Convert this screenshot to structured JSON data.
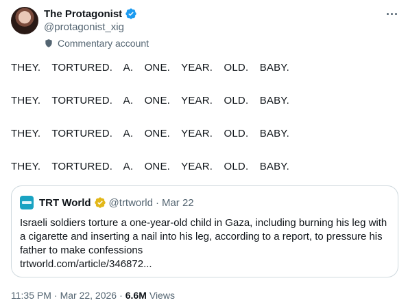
{
  "author": {
    "display_name": "The Protagonist",
    "handle": "@protagonist_xig",
    "label": "Commentary account"
  },
  "post": {
    "lines": [
      "THEY. TORTURED. A. ONE. YEAR. OLD. BABY.",
      "THEY. TORTURED. A. ONE. YEAR. OLD. BABY.",
      "THEY. TORTURED. A. ONE. YEAR. OLD. BABY.",
      "THEY. TORTURED. A. ONE. YEAR. OLD. BABY."
    ]
  },
  "quote": {
    "display_name": "TRT World",
    "handle": "@trtworld",
    "separator": "·",
    "date": "Mar 22",
    "text": "Israeli soldiers torture a one-year-old child in Gaza, including burning his leg with a cigarette and inserting a nail into his leg, according to a report, to pressure his father to make confessions",
    "link": "trtworld.com/article/346872..."
  },
  "meta": {
    "time": "11:35 PM",
    "separator": "·",
    "date": "Mar 22, 2026",
    "views_count": "6.6M",
    "views_label": "Views"
  },
  "colors": {
    "text_primary": "#0f1419",
    "text_secondary": "#536471",
    "verified_blue": "#1d9bf0",
    "verified_gold": "#e2b719",
    "border": "#cfd9de"
  }
}
